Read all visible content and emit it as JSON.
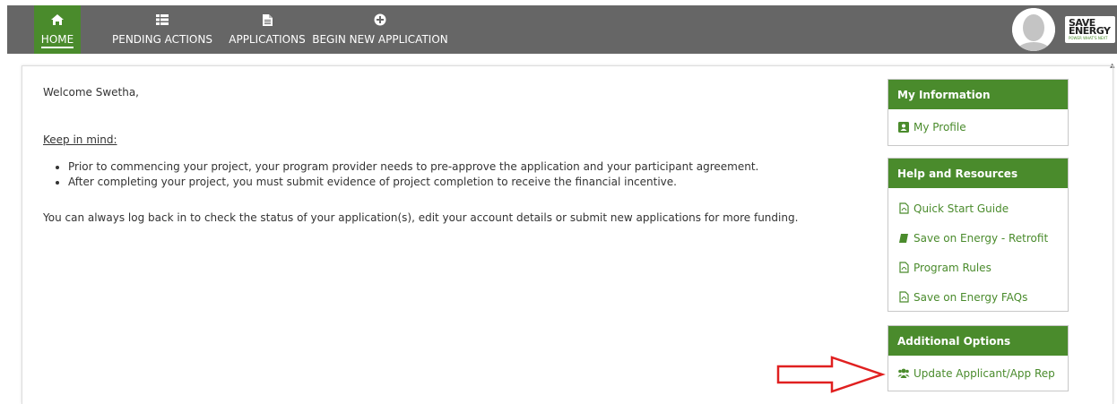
{
  "nav": {
    "items": [
      {
        "label": "HOME",
        "icon": "home-icon",
        "active": true
      },
      {
        "label": "PENDING ACTIONS",
        "icon": "list-icon",
        "active": false
      },
      {
        "label": "APPLICATIONS",
        "icon": "document-icon",
        "active": false
      },
      {
        "label": "BEGIN NEW APPLICATION",
        "icon": "plus-circle-icon",
        "active": false
      }
    ],
    "logo": {
      "line1": "SAVE",
      "line2": "ENERGY",
      "tagline": "POWER WHAT'S NEXT"
    }
  },
  "main": {
    "welcome": "Welcome Swetha,",
    "keep_in_mind": "Keep in mind:",
    "bullets": [
      "Prior to commencing your project, your program provider needs to pre-approve the application and your participant agreement.",
      "After completing your project, you must submit evidence of project completion to receive the financial incentive."
    ],
    "closing": "You can always log back in to check the status of your application(s), edit your account details or submit new applications for more funding."
  },
  "sidebar": {
    "my_information": {
      "title": "My Information",
      "links": [
        {
          "label": "My Profile",
          "icon": "profile-card-icon"
        }
      ]
    },
    "help_resources": {
      "title": "Help and Resources",
      "links": [
        {
          "label": "Quick Start Guide",
          "icon": "pdf-icon"
        },
        {
          "label": "Save on Energy - Retrofit",
          "icon": "book-icon"
        },
        {
          "label": "Program Rules",
          "icon": "pdf-icon"
        },
        {
          "label": "Save on Energy FAQs",
          "icon": "pdf-icon"
        }
      ]
    },
    "additional_options": {
      "title": "Additional Options",
      "links": [
        {
          "label": "Update Applicant/App Rep",
          "icon": "users-icon"
        }
      ]
    }
  },
  "colors": {
    "brand_green": "#4a8b2c",
    "nav_gray": "#666666",
    "arrow_red": "#e02020"
  }
}
